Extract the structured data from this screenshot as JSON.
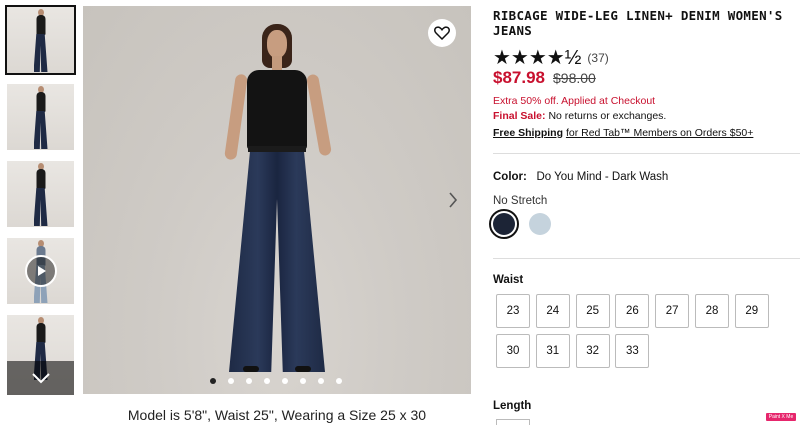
{
  "product": {
    "title": "RIBCAGE WIDE-LEG LINEN+ DENIM WOMEN'S JEANS",
    "rating_stars": "★★★★½",
    "rating_value": 4.5,
    "review_count": "(37)",
    "price_now": "$87.98",
    "price_was": "$98.00",
    "promo": "Extra 50% off. Applied at Checkout",
    "final_sale_label": "Final Sale:",
    "final_sale_text": "No returns or exchanges.",
    "shipping_bold": "Free Shipping",
    "shipping_text": "for Red Tab™ Members on Orders $50+"
  },
  "gallery": {
    "caption": "Model is 5'8\", Waist 25\", Wearing a Size 25 x 30",
    "dots_count": 8,
    "active_dot": 0
  },
  "color": {
    "label": "Color:",
    "value": "Do You Mind - Dark Wash",
    "stretch": "No Stretch",
    "swatches": [
      {
        "name": "dark-wash",
        "hex": "#1c2436",
        "selected": true
      },
      {
        "name": "light-wash",
        "hex": "#c5d3dd",
        "selected": false
      }
    ]
  },
  "waist": {
    "label": "Waist",
    "sizes": [
      "23",
      "24",
      "25",
      "26",
      "27",
      "28",
      "29",
      "30",
      "31",
      "32",
      "33"
    ]
  },
  "length": {
    "label": "Length"
  },
  "badge": {
    "text": "Paint X Me"
  },
  "icons": {
    "favorite": "heart-icon",
    "next": "chevron-right-icon",
    "thumb_nav": "chevron-down-icon",
    "play": "play-icon"
  },
  "colors": {
    "accent_red": "#c8102e",
    "text": "#111111"
  }
}
